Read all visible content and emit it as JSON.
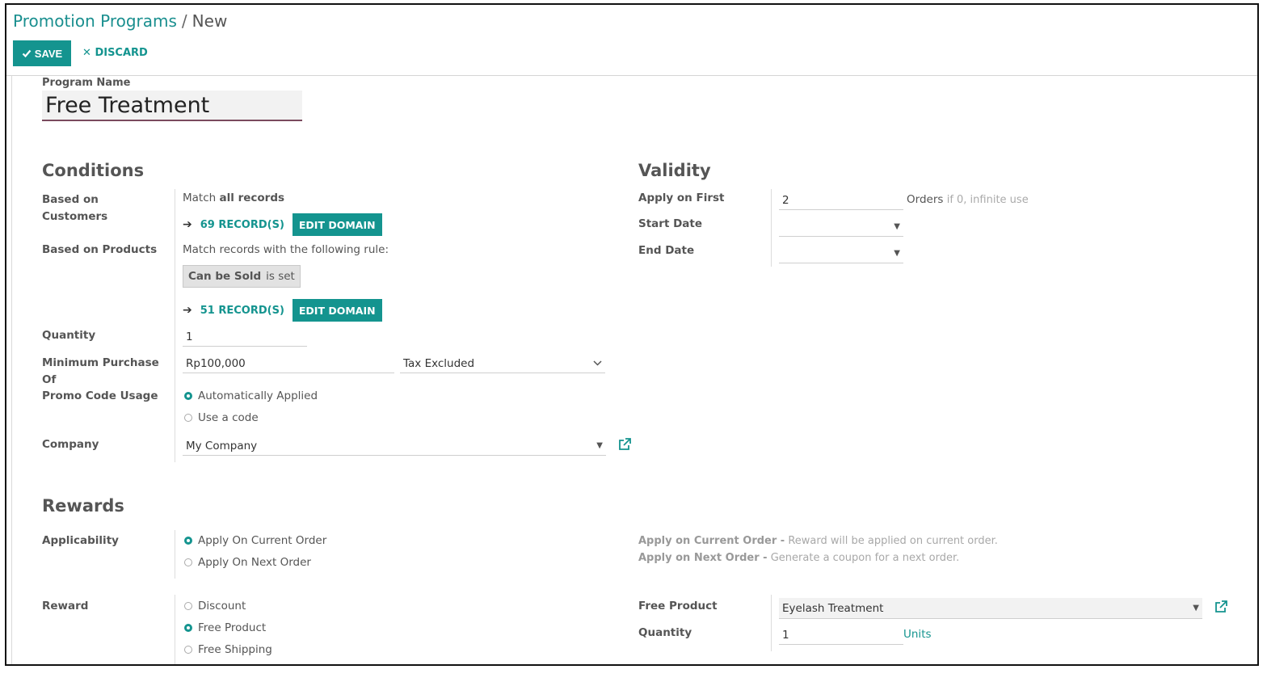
{
  "breadcrumb": {
    "parent": "Promotion Programs",
    "separator": "/",
    "current": "New"
  },
  "toolbar": {
    "save_label": "SAVE",
    "discard_label": "DISCARD"
  },
  "program_name": {
    "label": "Program Name",
    "value": "Free Treatment"
  },
  "conditions": {
    "heading": "Conditions",
    "based_on_customers": {
      "label": "Based on Customers",
      "match_prefix": "Match",
      "match_bold": "all records",
      "records_link": "69 RECORD(S)",
      "edit_domain": "EDIT DOMAIN"
    },
    "based_on_products": {
      "label": "Based on Products",
      "rule_text": "Match records with the following rule:",
      "chip_field": "Can be Sold",
      "chip_op": "is set",
      "records_link": "51 RECORD(S)",
      "edit_domain": "EDIT DOMAIN"
    },
    "quantity": {
      "label": "Quantity",
      "value": "1"
    },
    "minimum_purchase": {
      "label": "Minimum Purchase Of",
      "value": "Rp100,000",
      "tax_mode": "Tax Excluded"
    },
    "promo_code_usage": {
      "label": "Promo Code Usage",
      "options": [
        "Automatically Applied",
        "Use a code"
      ],
      "selected": "Automatically Applied"
    },
    "company": {
      "label": "Company",
      "value": "My Company"
    }
  },
  "validity": {
    "heading": "Validity",
    "apply_on_first": {
      "label": "Apply on First",
      "value": "2",
      "suffix": "Orders",
      "hint": "if 0, infinite use"
    },
    "start_date": {
      "label": "Start Date",
      "value": ""
    },
    "end_date": {
      "label": "End Date",
      "value": ""
    }
  },
  "rewards": {
    "heading": "Rewards",
    "applicability": {
      "label": "Applicability",
      "options": [
        "Apply On Current Order",
        "Apply On Next Order"
      ],
      "selected": "Apply On Current Order",
      "help": [
        {
          "term": "Apply on Current Order -",
          "desc": "Reward will be applied on current order."
        },
        {
          "term": "Apply on Next Order -",
          "desc": "Generate a coupon for a next order."
        }
      ]
    },
    "reward": {
      "label": "Reward",
      "options": [
        "Discount",
        "Free Product",
        "Free Shipping"
      ],
      "selected": "Free Product"
    },
    "free_product": {
      "label": "Free Product",
      "value": "Eyelash Treatment"
    },
    "quantity": {
      "label": "Quantity",
      "value": "1",
      "unit": "Units"
    }
  },
  "icons": {
    "save": "check-icon",
    "discard": "x-icon",
    "records": "arrow-right-icon",
    "external": "external-link-icon",
    "dropdown": "caret-down-icon"
  },
  "colors": {
    "accent": "#14948f",
    "title_underline": "#7a4a5e"
  }
}
